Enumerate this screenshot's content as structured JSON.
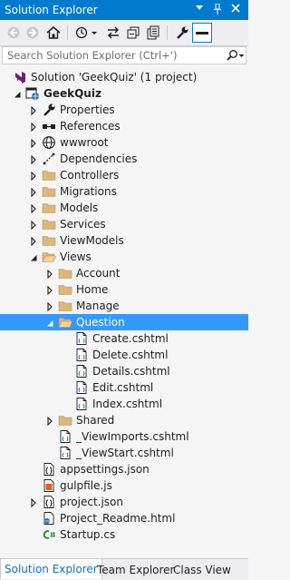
{
  "window": {
    "title": "Solution Explorer"
  },
  "search": {
    "placeholder": "Search Solution Explorer (Ctrl+')"
  },
  "tree": [
    {
      "label": "Solution 'GeekQuiz' (1 project)",
      "icon": "solution-icon",
      "arrow": "none",
      "bold": false,
      "selected": false,
      "level": 0
    },
    {
      "label": "GeekQuiz",
      "icon": "web-project-icon",
      "arrow": "expanded",
      "bold": true,
      "selected": false,
      "level": 1
    },
    {
      "label": "Properties",
      "icon": "wrench-icon",
      "arrow": "collapsed",
      "bold": false,
      "selected": false,
      "level": 2
    },
    {
      "label": "References",
      "icon": "references-icon",
      "arrow": "collapsed",
      "bold": false,
      "selected": false,
      "level": 2
    },
    {
      "label": "wwwroot",
      "icon": "globe-icon",
      "arrow": "collapsed",
      "bold": false,
      "selected": false,
      "level": 2
    },
    {
      "label": "Dependencies",
      "icon": "dependencies-icon",
      "arrow": "collapsed",
      "bold": false,
      "selected": false,
      "level": 2
    },
    {
      "label": "Controllers",
      "icon": "folder-icon",
      "arrow": "collapsed",
      "bold": false,
      "selected": false,
      "level": 2
    },
    {
      "label": "Migrations",
      "icon": "folder-icon",
      "arrow": "collapsed",
      "bold": false,
      "selected": false,
      "level": 2
    },
    {
      "label": "Models",
      "icon": "folder-icon",
      "arrow": "collapsed",
      "bold": false,
      "selected": false,
      "level": 2
    },
    {
      "label": "Services",
      "icon": "folder-icon",
      "arrow": "collapsed",
      "bold": false,
      "selected": false,
      "level": 2
    },
    {
      "label": "ViewModels",
      "icon": "folder-icon",
      "arrow": "collapsed",
      "bold": false,
      "selected": false,
      "level": 2
    },
    {
      "label": "Views",
      "icon": "folder-open-icon",
      "arrow": "expanded",
      "bold": false,
      "selected": false,
      "level": 2
    },
    {
      "label": "Account",
      "icon": "folder-icon",
      "arrow": "collapsed",
      "bold": false,
      "selected": false,
      "level": 3
    },
    {
      "label": "Home",
      "icon": "folder-icon",
      "arrow": "collapsed",
      "bold": false,
      "selected": false,
      "level": 3
    },
    {
      "label": "Manage",
      "icon": "folder-icon",
      "arrow": "collapsed",
      "bold": false,
      "selected": false,
      "level": 3
    },
    {
      "label": "Question",
      "icon": "folder-open-icon",
      "arrow": "expanded",
      "bold": false,
      "selected": true,
      "level": 3
    },
    {
      "label": "Create.cshtml",
      "icon": "cshtml-file-icon",
      "arrow": "none",
      "bold": false,
      "selected": false,
      "level": 4
    },
    {
      "label": "Delete.cshtml",
      "icon": "cshtml-file-icon",
      "arrow": "none",
      "bold": false,
      "selected": false,
      "level": 4
    },
    {
      "label": "Details.cshtml",
      "icon": "cshtml-file-icon",
      "arrow": "none",
      "bold": false,
      "selected": false,
      "level": 4
    },
    {
      "label": "Edit.cshtml",
      "icon": "cshtml-file-icon",
      "arrow": "none",
      "bold": false,
      "selected": false,
      "level": 4
    },
    {
      "label": "Index.cshtml",
      "icon": "cshtml-file-icon",
      "arrow": "none",
      "bold": false,
      "selected": false,
      "level": 4
    },
    {
      "label": "Shared",
      "icon": "folder-icon",
      "arrow": "collapsed",
      "bold": false,
      "selected": false,
      "level": 3
    },
    {
      "label": "_ViewImports.cshtml",
      "icon": "cshtml-file-icon",
      "arrow": "none",
      "bold": false,
      "selected": false,
      "level": 3
    },
    {
      "label": "_ViewStart.cshtml",
      "icon": "cshtml-file-icon",
      "arrow": "none",
      "bold": false,
      "selected": false,
      "level": 3
    },
    {
      "label": "appsettings.json",
      "icon": "json-file-icon",
      "arrow": "none",
      "bold": false,
      "selected": false,
      "level": 2
    },
    {
      "label": "gulpfile.js",
      "icon": "js-file-icon",
      "arrow": "none",
      "bold": false,
      "selected": false,
      "level": 2
    },
    {
      "label": "project.json",
      "icon": "json-file-icon",
      "arrow": "collapsed",
      "bold": false,
      "selected": false,
      "level": 2
    },
    {
      "label": "Project_Readme.html",
      "icon": "html-file-icon",
      "arrow": "none",
      "bold": false,
      "selected": false,
      "level": 2
    },
    {
      "label": "Startup.cs",
      "icon": "csharp-file-icon",
      "arrow": "none",
      "bold": false,
      "selected": false,
      "level": 2
    }
  ],
  "tabs": [
    {
      "label": "Solution Explorer",
      "active": true
    },
    {
      "label": "Team Explorer",
      "active": false
    },
    {
      "label": "Class View",
      "active": false
    }
  ],
  "colors": {
    "accent": "#007acc",
    "selection": "#3399ff",
    "folder": "#dcb67a",
    "csharp": "#388a34"
  }
}
